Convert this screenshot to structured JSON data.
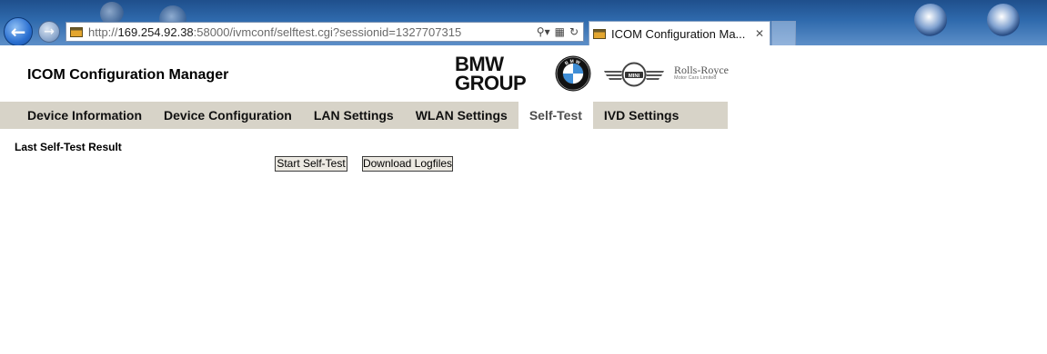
{
  "browser": {
    "url_prefix": "http://",
    "url_host": "169.254.92.38",
    "url_rest": ":58000/ivmconf/selftest.cgi?sessionid=1327707315",
    "tab_title": "ICOM Configuration Ma...",
    "icons": [
      "back-arrow-icon",
      "forward-arrow-icon",
      "search-icon",
      "compatibility-icon",
      "refresh-icon",
      "close-icon"
    ]
  },
  "header": {
    "app_title": "ICOM Configuration Manager",
    "logos": {
      "bmw_group_line1": "BMW",
      "bmw_group_line2": "GROUP",
      "bmw_roundel_letters": "BMW",
      "mini": "MINI",
      "rolls_royce_line1": "Rolls-Royce",
      "rolls_royce_line2": "Motor Cars Limited"
    }
  },
  "menu": {
    "items": [
      {
        "label": "Device Information",
        "active": false
      },
      {
        "label": "Device Configuration",
        "active": false
      },
      {
        "label": "LAN Settings",
        "active": false
      },
      {
        "label": "WLAN Settings",
        "active": false
      },
      {
        "label": "Self-Test",
        "active": true
      },
      {
        "label": "IVD Settings",
        "active": false
      }
    ]
  },
  "main": {
    "result_label": "Last Self-Test Result",
    "start_button": "Start Self-Test",
    "download_button": "Download Logfiles"
  },
  "colors": {
    "menu_bg": "#d7d3c8",
    "active_tab_bg": "#ffffff",
    "active_tab_text": "#4d4d4d",
    "chrome_blue": "#2f6aad"
  }
}
